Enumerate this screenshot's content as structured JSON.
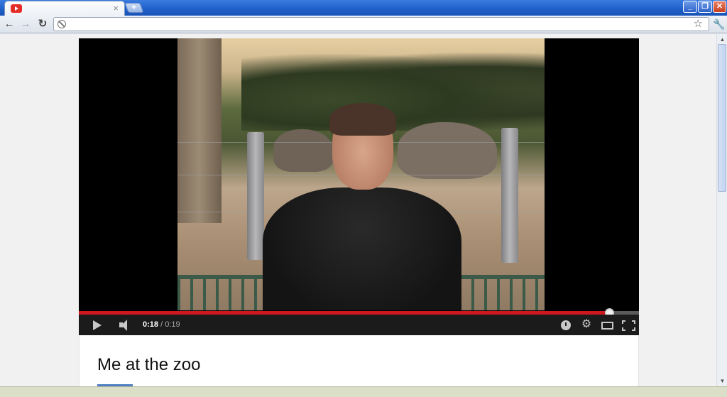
{
  "browser": {
    "tab": {
      "close_glyph": "×",
      "favicon": "youtube-favicon"
    },
    "new_tab_glyph": "+",
    "window_buttons": {
      "minimize": "_",
      "maximize": "❐",
      "close": "✕"
    },
    "nav": {
      "back": "←",
      "forward": "→",
      "reload": "↻"
    },
    "address": {
      "value": "",
      "placeholder": ""
    },
    "star_glyph": "☆",
    "wrench_glyph": "🔧"
  },
  "player": {
    "progress": {
      "fraction": 0.947,
      "color": "#cc181e"
    },
    "time": {
      "current": "0:18",
      "separator": " / ",
      "duration": "0:19"
    },
    "gear_glyph": "⚙"
  },
  "video": {
    "title": "Me at the zoo"
  },
  "scrollbar": {
    "up": "▲",
    "down": "▼"
  }
}
